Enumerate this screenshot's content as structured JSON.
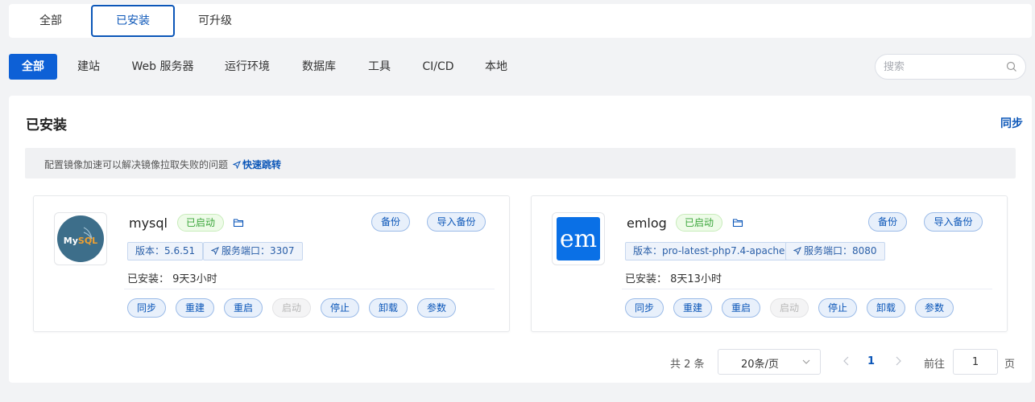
{
  "top_tabs": [
    {
      "label": "全部"
    },
    {
      "label": "已安装",
      "active": true
    },
    {
      "label": "可升级"
    }
  ],
  "categories": [
    {
      "label": "全部",
      "active": true
    },
    {
      "label": "建站"
    },
    {
      "label": "Web 服务器"
    },
    {
      "label": "运行环境"
    },
    {
      "label": "数据库"
    },
    {
      "label": "工具"
    },
    {
      "label": "CI/CD"
    },
    {
      "label": "本地"
    }
  ],
  "search": {
    "placeholder": "搜索"
  },
  "panel": {
    "title": "已安装",
    "sync_label": "同步",
    "notice_text": "配置镜像加速可以解决镜像拉取失败的问题",
    "notice_link": "快速跳转"
  },
  "apps": [
    {
      "name": "mysql",
      "status": "已启动",
      "backup_label": "备份",
      "import_backup_label": "导入备份",
      "version_tag": "版本：5.6.51",
      "port_tag": "服务端口：3307",
      "installed": "已安装：  9天3小时",
      "logo": {
        "kind": "mysql-logo",
        "text": "MySQL",
        "color": "#3d6e8a"
      },
      "actions": [
        "同步",
        "重建",
        "重启",
        "启动",
        "停止",
        "卸载",
        "参数"
      ]
    },
    {
      "name": "emlog",
      "status": "已启动",
      "backup_label": "备份",
      "import_backup_label": "导入备份",
      "version_tag": "版本：pro-latest-php7.4-apache",
      "port_tag": "服务端口：8080",
      "installed": "已安装：  8天13小时",
      "logo": {
        "kind": "emlog-logo",
        "text": "em",
        "color": "#0a70e6"
      },
      "actions": [
        "同步",
        "重建",
        "重启",
        "启动",
        "停止",
        "卸载",
        "参数"
      ]
    }
  ],
  "pagination": {
    "total": "共 2 条",
    "page_size": "20条/页",
    "current": "1",
    "goto_label": "前往",
    "goto_value": "1",
    "page_unit": "页"
  },
  "colors": {
    "accent": "#0d60d6",
    "link": "#0b56b8",
    "running": "#3ba63b"
  }
}
